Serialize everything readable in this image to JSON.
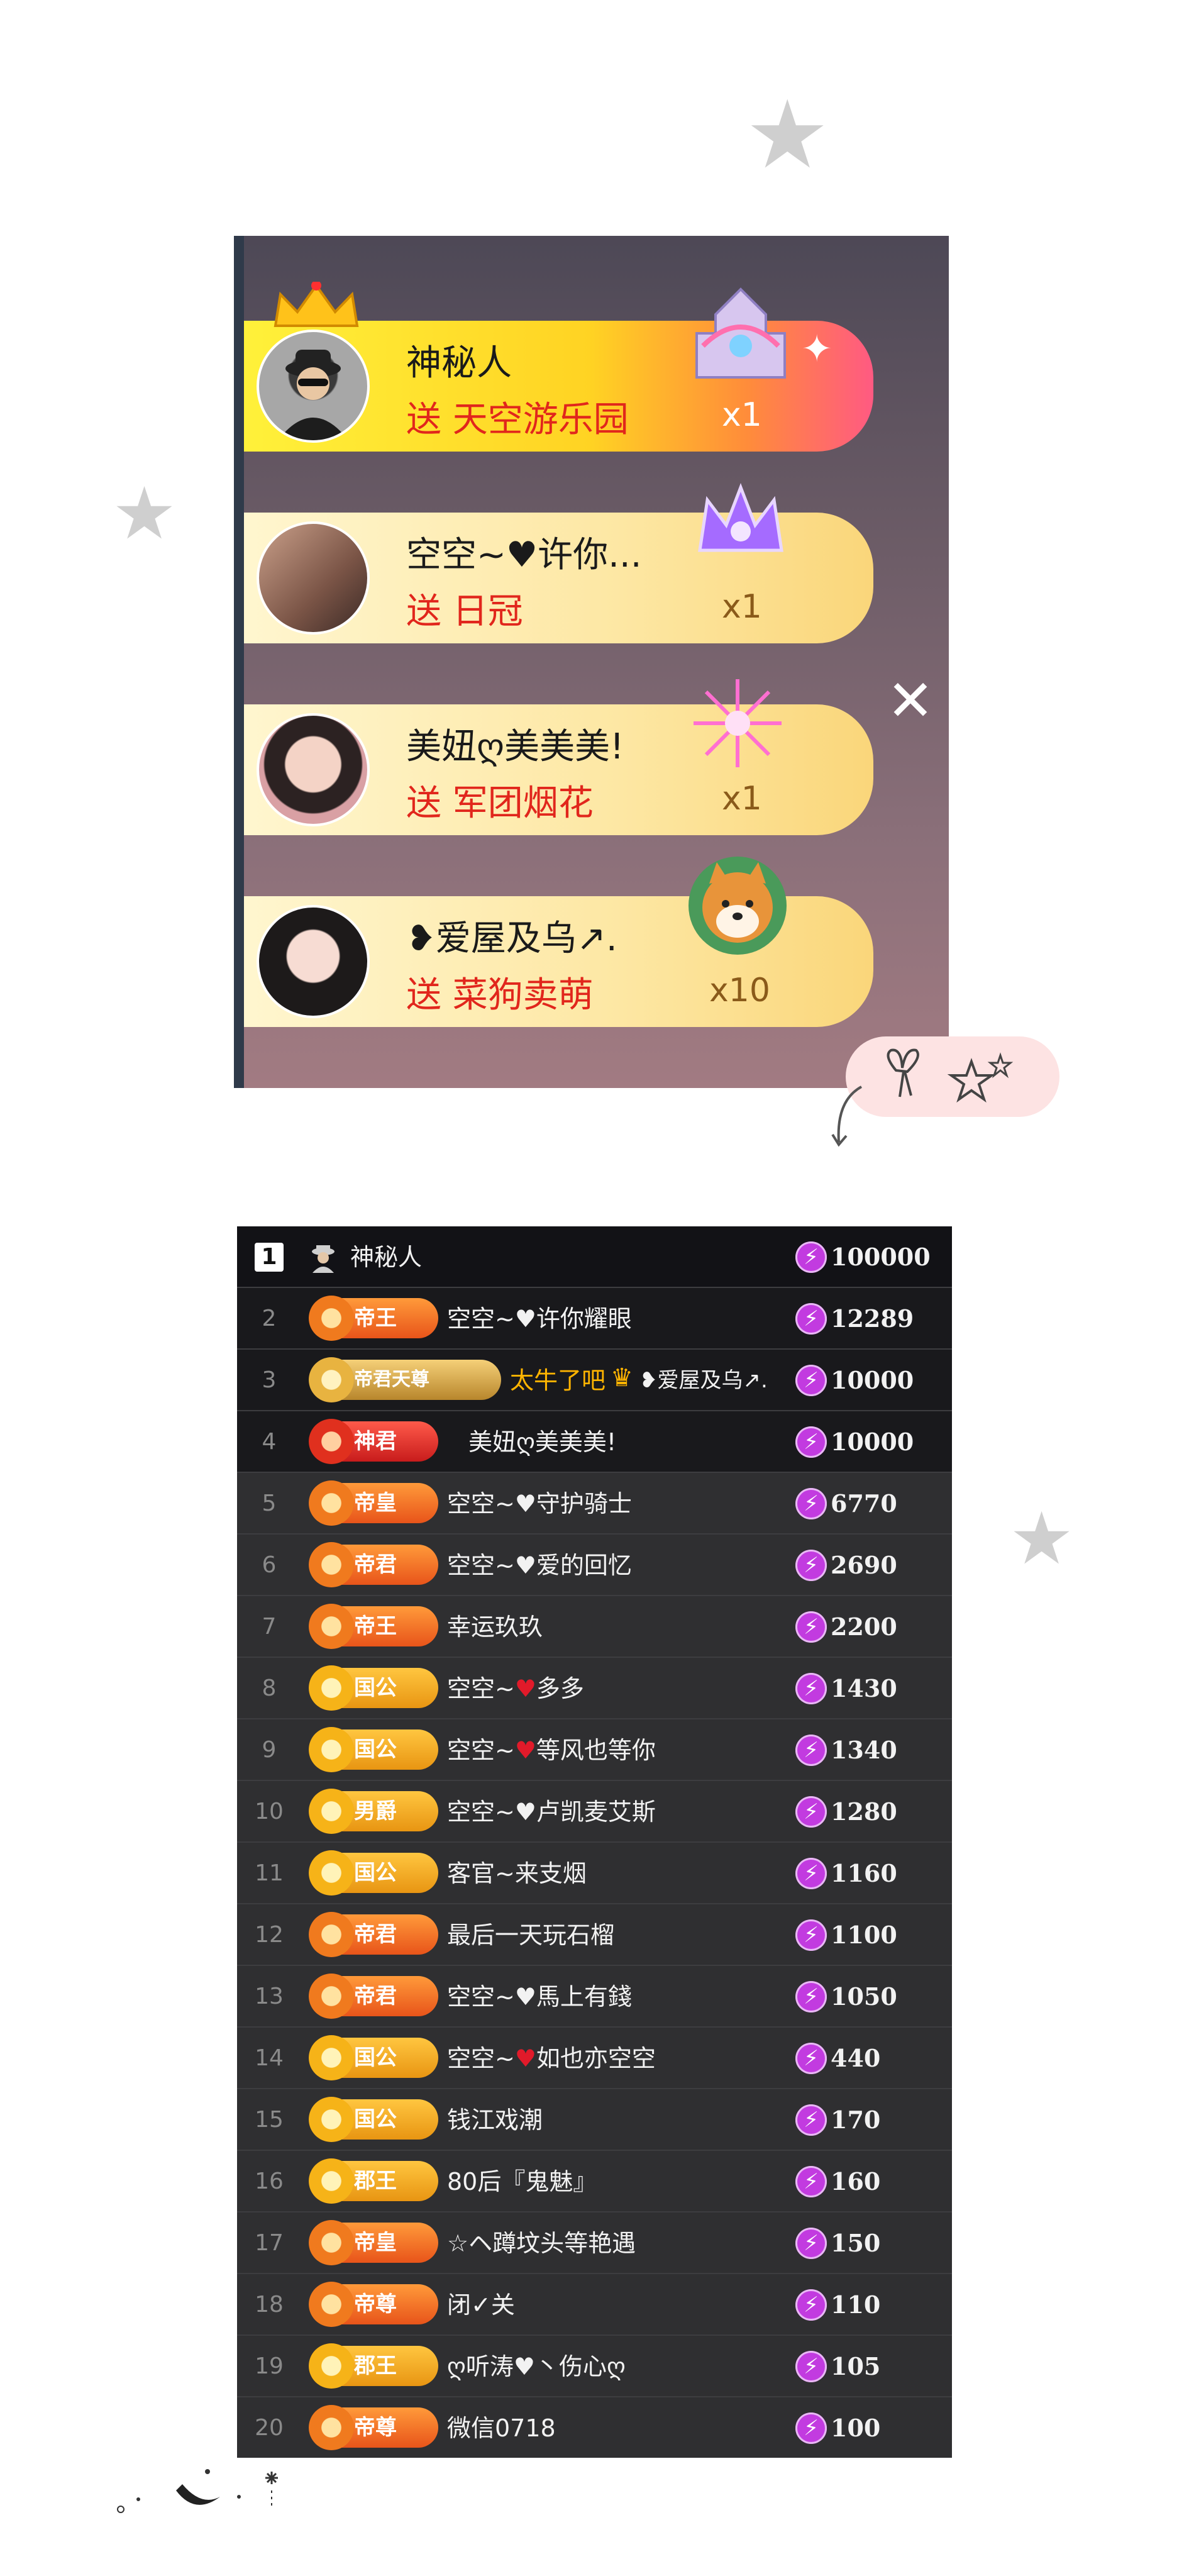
{
  "gift_panel": {
    "close_glyph": "✕",
    "rows": [
      {
        "name": "神秘人",
        "action": "送 天空游乐园",
        "count": "x1",
        "gift_icon": "castle-gift-icon"
      },
      {
        "name": "空空~♥许你...",
        "action": "送 日冠",
        "count": "x1",
        "gift_icon": "crown-gift-icon"
      },
      {
        "name": "美妞ღ美美美!",
        "action": "送 军团烟花",
        "count": "x1",
        "gift_icon": "firework-gift-icon"
      },
      {
        "name": "❥爱屋及乌↗.",
        "action": "送 菜狗卖萌",
        "count": "x10",
        "gift_icon": "shiba-dog-gift-icon"
      }
    ]
  },
  "leaderboard": {
    "rows": [
      {
        "rank": "1",
        "badge": "",
        "name": "神秘人",
        "score": "100000"
      },
      {
        "rank": "2",
        "badge": "帝王",
        "name": "空空~♥许你耀眼",
        "score": "12289"
      },
      {
        "rank": "3",
        "badge": "帝君天尊",
        "name": "太牛了吧",
        "name_extra": "❥爱屋及乌↗.",
        "score": "10000"
      },
      {
        "rank": "4",
        "badge": "神君",
        "name": "美妞ღ美美美!",
        "score": "10000"
      },
      {
        "rank": "5",
        "badge": "帝皇",
        "name": "空空~♥守护骑士",
        "score": "6770"
      },
      {
        "rank": "6",
        "badge": "帝君",
        "name": "空空~♥爱的回忆",
        "score": "2690"
      },
      {
        "rank": "7",
        "badge": "帝王",
        "name": "幸运玖玖",
        "score": "2200"
      },
      {
        "rank": "8",
        "badge": "国公",
        "name": "空空~",
        "name_heart": "♥",
        "name_tail": "多多",
        "score": "1430"
      },
      {
        "rank": "9",
        "badge": "国公",
        "name": "空空~",
        "name_heart": "♥",
        "name_tail": "等风也等你",
        "score": "1340"
      },
      {
        "rank": "10",
        "badge": "男爵",
        "name": "空空~♥卢凯麦艾斯",
        "score": "1280"
      },
      {
        "rank": "11",
        "badge": "国公",
        "name": "客官~来支烟",
        "score": "1160"
      },
      {
        "rank": "12",
        "badge": "帝君",
        "name": "最后一天玩石榴",
        "score": "1100"
      },
      {
        "rank": "13",
        "badge": "帝君",
        "name": "空空~♥馬上有錢",
        "score": "1050"
      },
      {
        "rank": "14",
        "badge": "国公",
        "name": "空空~",
        "name_heart": "♥",
        "name_tail": "如也亦空空",
        "score": "440"
      },
      {
        "rank": "15",
        "badge": "国公",
        "name": "钱江戏潮",
        "score": "170"
      },
      {
        "rank": "16",
        "badge": "郡王",
        "name": "80后『鬼魅』",
        "score": "160"
      },
      {
        "rank": "17",
        "badge": "帝皇",
        "name": "☆ヘ蹲坟头等艳遇",
        "score": "150"
      },
      {
        "rank": "18",
        "badge": "帝尊",
        "name": "闭✓关",
        "score": "110"
      },
      {
        "rank": "19",
        "badge": "郡王",
        "name": "ღ听涛♥丶伤心ღ",
        "score": "105"
      },
      {
        "rank": "20",
        "badge": "帝尊",
        "name": "微信0718",
        "score": "100"
      }
    ]
  },
  "colors": {
    "gift_action": "#e1261c",
    "leaderboard_bg": "#2f2f31",
    "bolt": "#c23be0"
  }
}
